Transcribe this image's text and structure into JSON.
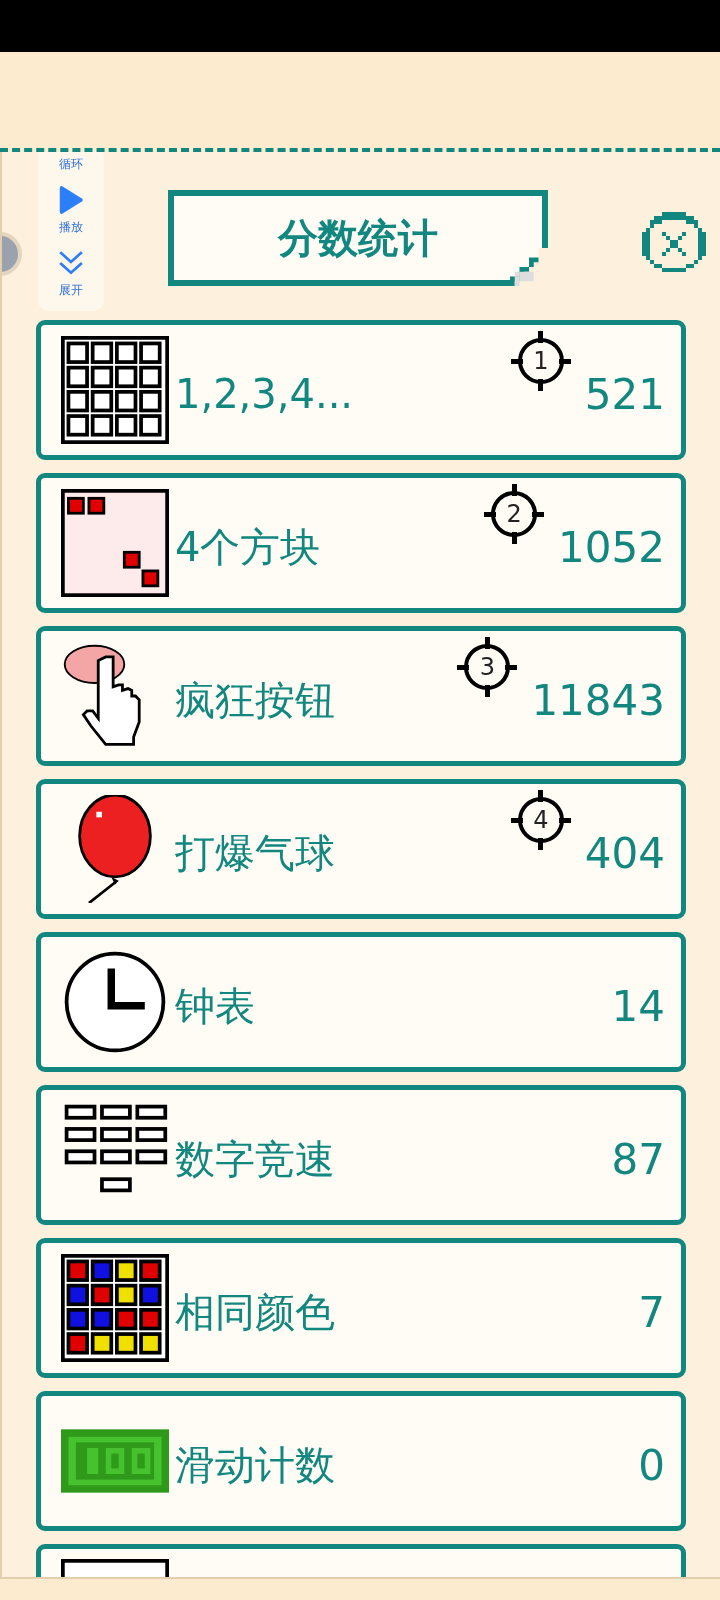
{
  "float_controls": [
    {
      "label": "循环"
    },
    {
      "label": "播放"
    },
    {
      "label": "展开"
    }
  ],
  "title": "分数统计",
  "games": [
    {
      "name": "1,2,3,4...",
      "rank": "1",
      "score": "521"
    },
    {
      "name": "4个方块",
      "rank": "2",
      "score": "1052"
    },
    {
      "name": "疯狂按钮",
      "rank": "3",
      "score": "11843"
    },
    {
      "name": "打爆气球",
      "rank": "4",
      "score": "404"
    },
    {
      "name": "钟表",
      "score": "14"
    },
    {
      "name": "数字竞速",
      "score": "87"
    },
    {
      "name": "相同颜色",
      "score": "7"
    },
    {
      "name": "滑动计数",
      "score": "0"
    }
  ]
}
